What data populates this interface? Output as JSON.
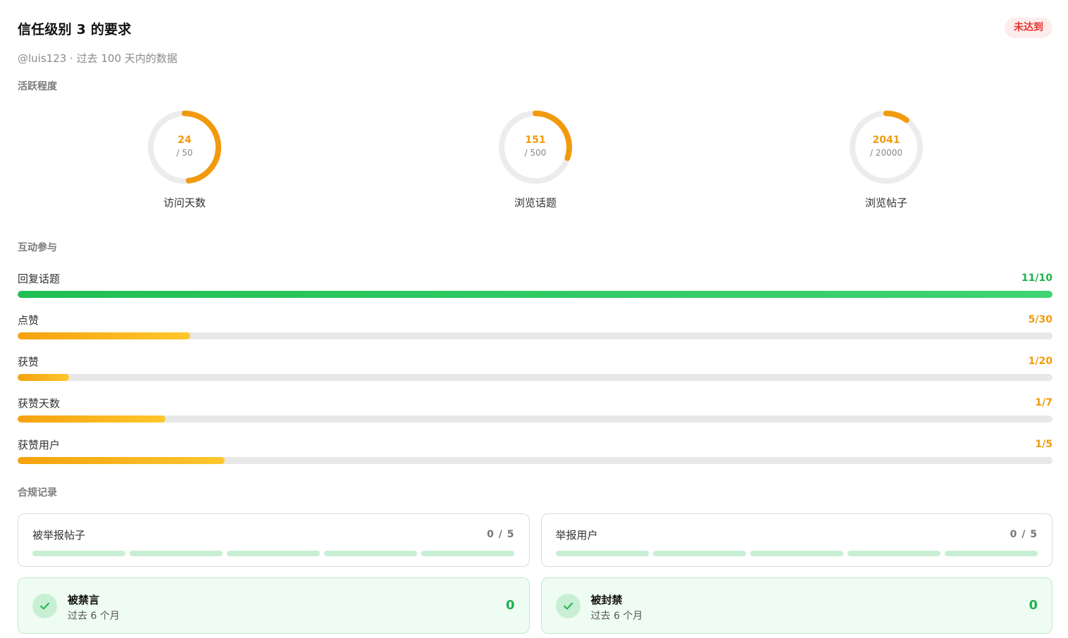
{
  "header": {
    "title": "信任级别 3 的要求",
    "subtitle": "@luis123 · 过去 100 天内的数据",
    "status_badge": "未达到"
  },
  "activity": {
    "section_title": "活跃程度",
    "rings": [
      {
        "label": "访问天数",
        "value_text": "24",
        "total_text": "/ 50",
        "value": 24,
        "total": 50
      },
      {
        "label": "浏览话题",
        "value_text": "151",
        "total_text": "/ 500",
        "value": 151,
        "total": 500
      },
      {
        "label": "浏览帖子",
        "value_text": "2041",
        "total_text": "/ 20000",
        "value": 2041,
        "total": 20000
      }
    ]
  },
  "interaction": {
    "section_title": "互动参与",
    "bars": [
      {
        "label": "回复话题",
        "count": "11/10",
        "value": 11,
        "total": 10,
        "met": true
      },
      {
        "label": "点赞",
        "count": "5/30",
        "value": 5,
        "total": 30,
        "met": false
      },
      {
        "label": "获赞",
        "count": "1/20",
        "value": 1,
        "total": 20,
        "met": false
      },
      {
        "label": "获赞天数",
        "count": "1/7",
        "value": 1,
        "total": 7,
        "met": false
      },
      {
        "label": "获赞用户",
        "count": "1/5",
        "value": 1,
        "total": 5,
        "met": false
      }
    ]
  },
  "compliance": {
    "section_title": "合规记录",
    "limit_cards": [
      {
        "label": "被举报帖子",
        "count": "0 / 5",
        "used": 0,
        "limit": 5
      },
      {
        "label": "举报用户",
        "count": "0 / 5",
        "used": 0,
        "limit": 5
      }
    ],
    "status_cards": [
      {
        "title": "被禁言",
        "subtitle": "过去 6 个月",
        "value": "0"
      },
      {
        "title": "被封禁",
        "subtitle": "过去 6 个月",
        "value": "0"
      }
    ]
  },
  "colors": {
    "ring_progress": "#f29a0d",
    "ring_track": "#ececec",
    "met_text": "#1fb24f",
    "unmet_text": "#f29a0d",
    "badge_text": "#e5322d",
    "badge_bg": "#fdecec"
  },
  "icons": {
    "status_check": "check-icon"
  }
}
